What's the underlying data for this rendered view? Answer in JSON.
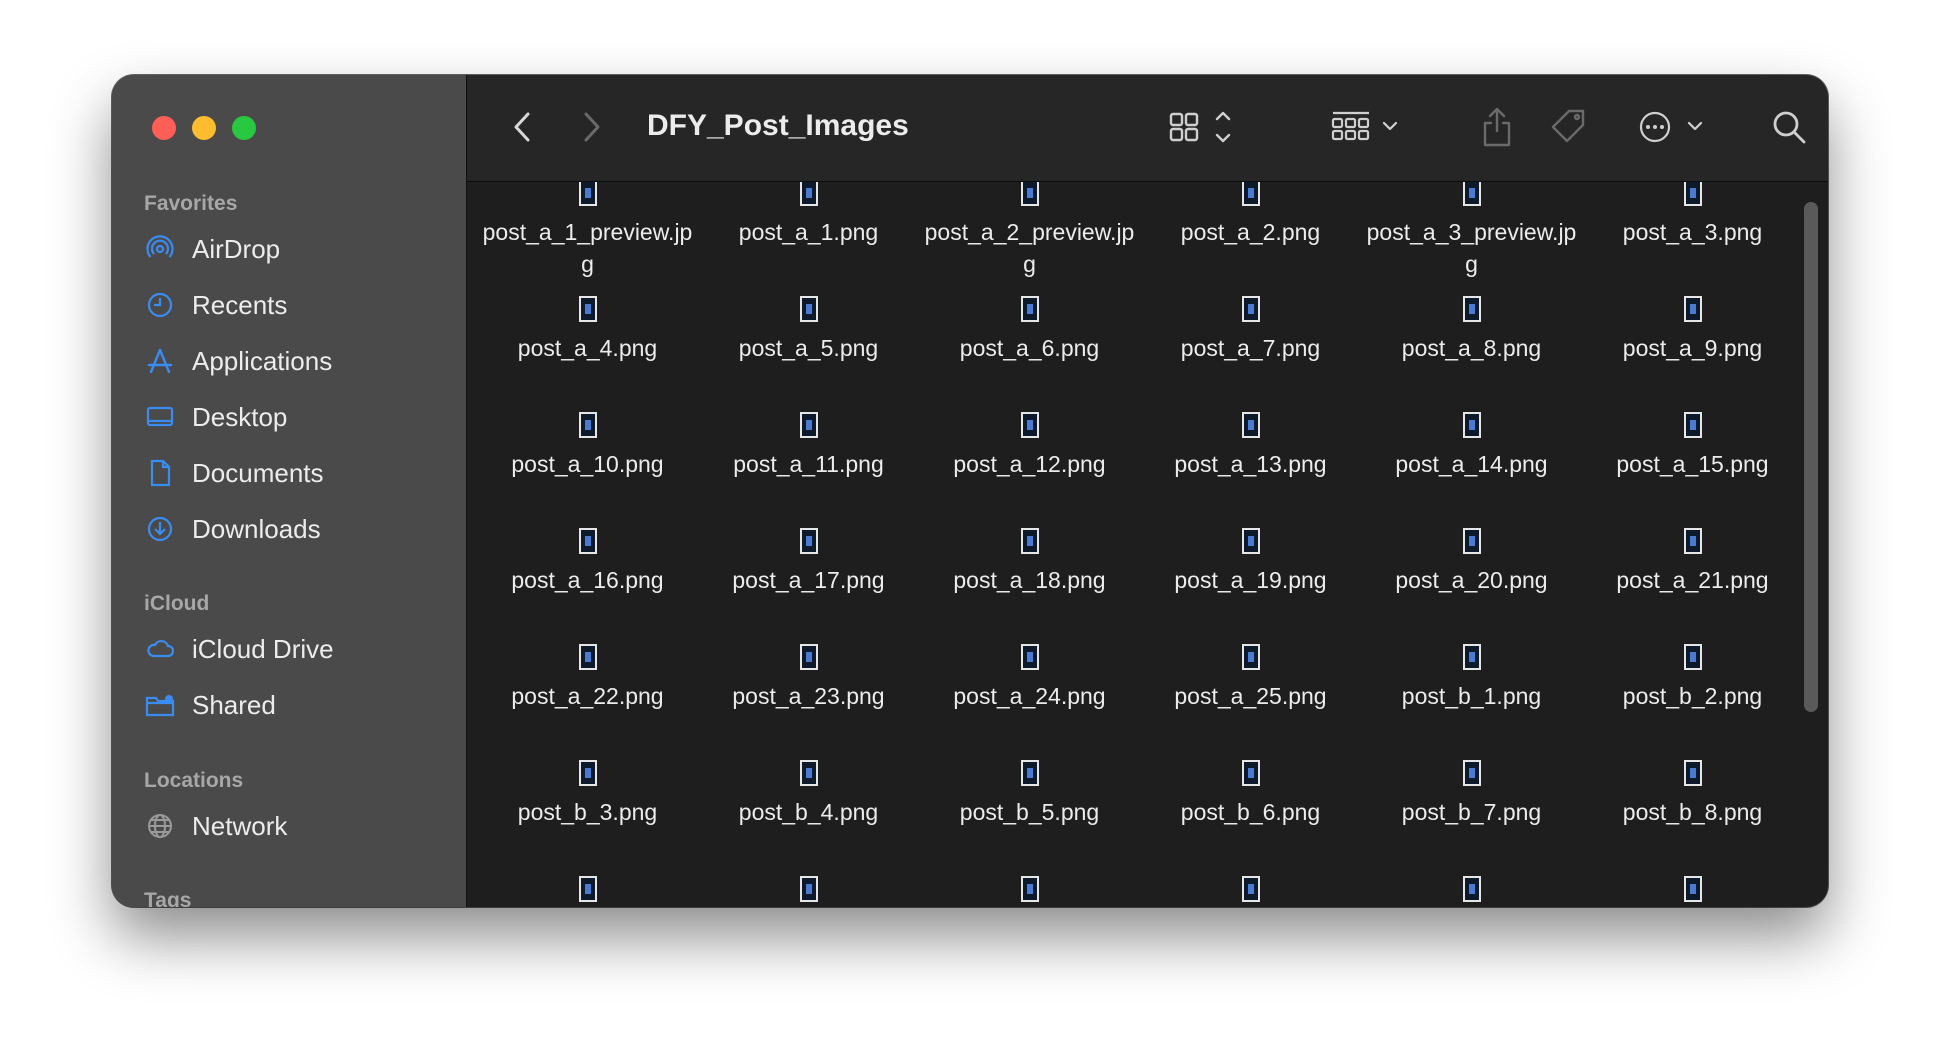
{
  "window": {
    "title": "DFY_Post_Images"
  },
  "sidebar": {
    "sections": {
      "favorites": "Favorites",
      "icloud": "iCloud",
      "locations": "Locations",
      "tags": "Tags"
    },
    "items": [
      {
        "label": "AirDrop",
        "icon": "airdrop-icon"
      },
      {
        "label": "Recents",
        "icon": "clock-icon"
      },
      {
        "label": "Applications",
        "icon": "applications-icon"
      },
      {
        "label": "Desktop",
        "icon": "desktop-icon"
      },
      {
        "label": "Documents",
        "icon": "document-icon"
      },
      {
        "label": "Downloads",
        "icon": "download-icon"
      },
      {
        "label": "iCloud Drive",
        "icon": "cloud-icon"
      },
      {
        "label": "Shared",
        "icon": "shared-folder-icon"
      },
      {
        "label": "Network",
        "icon": "globe-icon"
      }
    ]
  },
  "toolbar": {
    "icons": [
      "back-icon",
      "forward-icon",
      "view-icons-icon",
      "group-icon",
      "share-icon",
      "tag-icon",
      "more-icon",
      "search-icon"
    ]
  },
  "files": [
    "post_a_1_preview.jpg",
    "post_a_1.png",
    "post_a_2_preview.jpg",
    "post_a_2.png",
    "post_a_3_preview.jpg",
    "post_a_3.png",
    "post_a_4.png",
    "post_a_5.png",
    "post_a_6.png",
    "post_a_7.png",
    "post_a_8.png",
    "post_a_9.png",
    "post_a_10.png",
    "post_a_11.png",
    "post_a_12.png",
    "post_a_13.png",
    "post_a_14.png",
    "post_a_15.png",
    "post_a_16.png",
    "post_a_17.png",
    "post_a_18.png",
    "post_a_19.png",
    "post_a_20.png",
    "post_a_21.png",
    "post_a_22.png",
    "post_a_23.png",
    "post_a_24.png",
    "post_a_25.png",
    "post_b_1.png",
    "post_b_2.png",
    "post_b_3.png",
    "post_b_4.png",
    "post_b_5.png",
    "post_b_6.png",
    "post_b_7.png",
    "post_b_8.png",
    "",
    "",
    "",
    "",
    "",
    ""
  ]
}
